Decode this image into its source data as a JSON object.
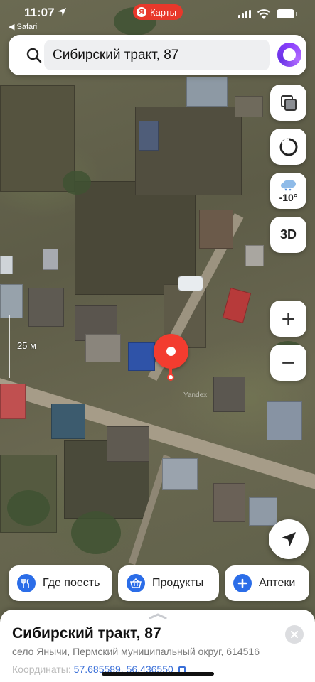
{
  "status_bar": {
    "time": "11:07",
    "back_label": "◀ Safari",
    "app_badge_letter": "Я",
    "app_badge_label": "Карты"
  },
  "search": {
    "query": "Сибирский тракт, 87",
    "search_icon": "search-icon",
    "assistant_icon": "alice-icon"
  },
  "controls": {
    "layers_icon": "layers-icon",
    "orientation_icon": "ring-icon",
    "weather_temp": "-10°",
    "three_d_label": "3D",
    "zoom_in_label": "+",
    "zoom_out_label": "−",
    "locate_icon": "navigation-arrow-icon"
  },
  "map": {
    "scale_label": "25 м",
    "watermark": "Yandex",
    "pin_color": "#f33c2f"
  },
  "chips": [
    {
      "label": "Где поесть",
      "icon": "fork-knife-icon"
    },
    {
      "label": "Продукты",
      "icon": "basket-icon"
    },
    {
      "label": "Аптеки",
      "icon": "plus-icon"
    }
  ],
  "sheet": {
    "title": "Сибирский тракт, 87",
    "subtitle": "село Янычи, Пермский муниципальный округ, 614516",
    "coords_label": "Координаты:",
    "coords_value": "57.685589, 56.436550"
  },
  "colors": {
    "accent_blue": "#2b6de8",
    "brand_red": "#e8382b",
    "alice_purple": "#8a3ffc"
  }
}
